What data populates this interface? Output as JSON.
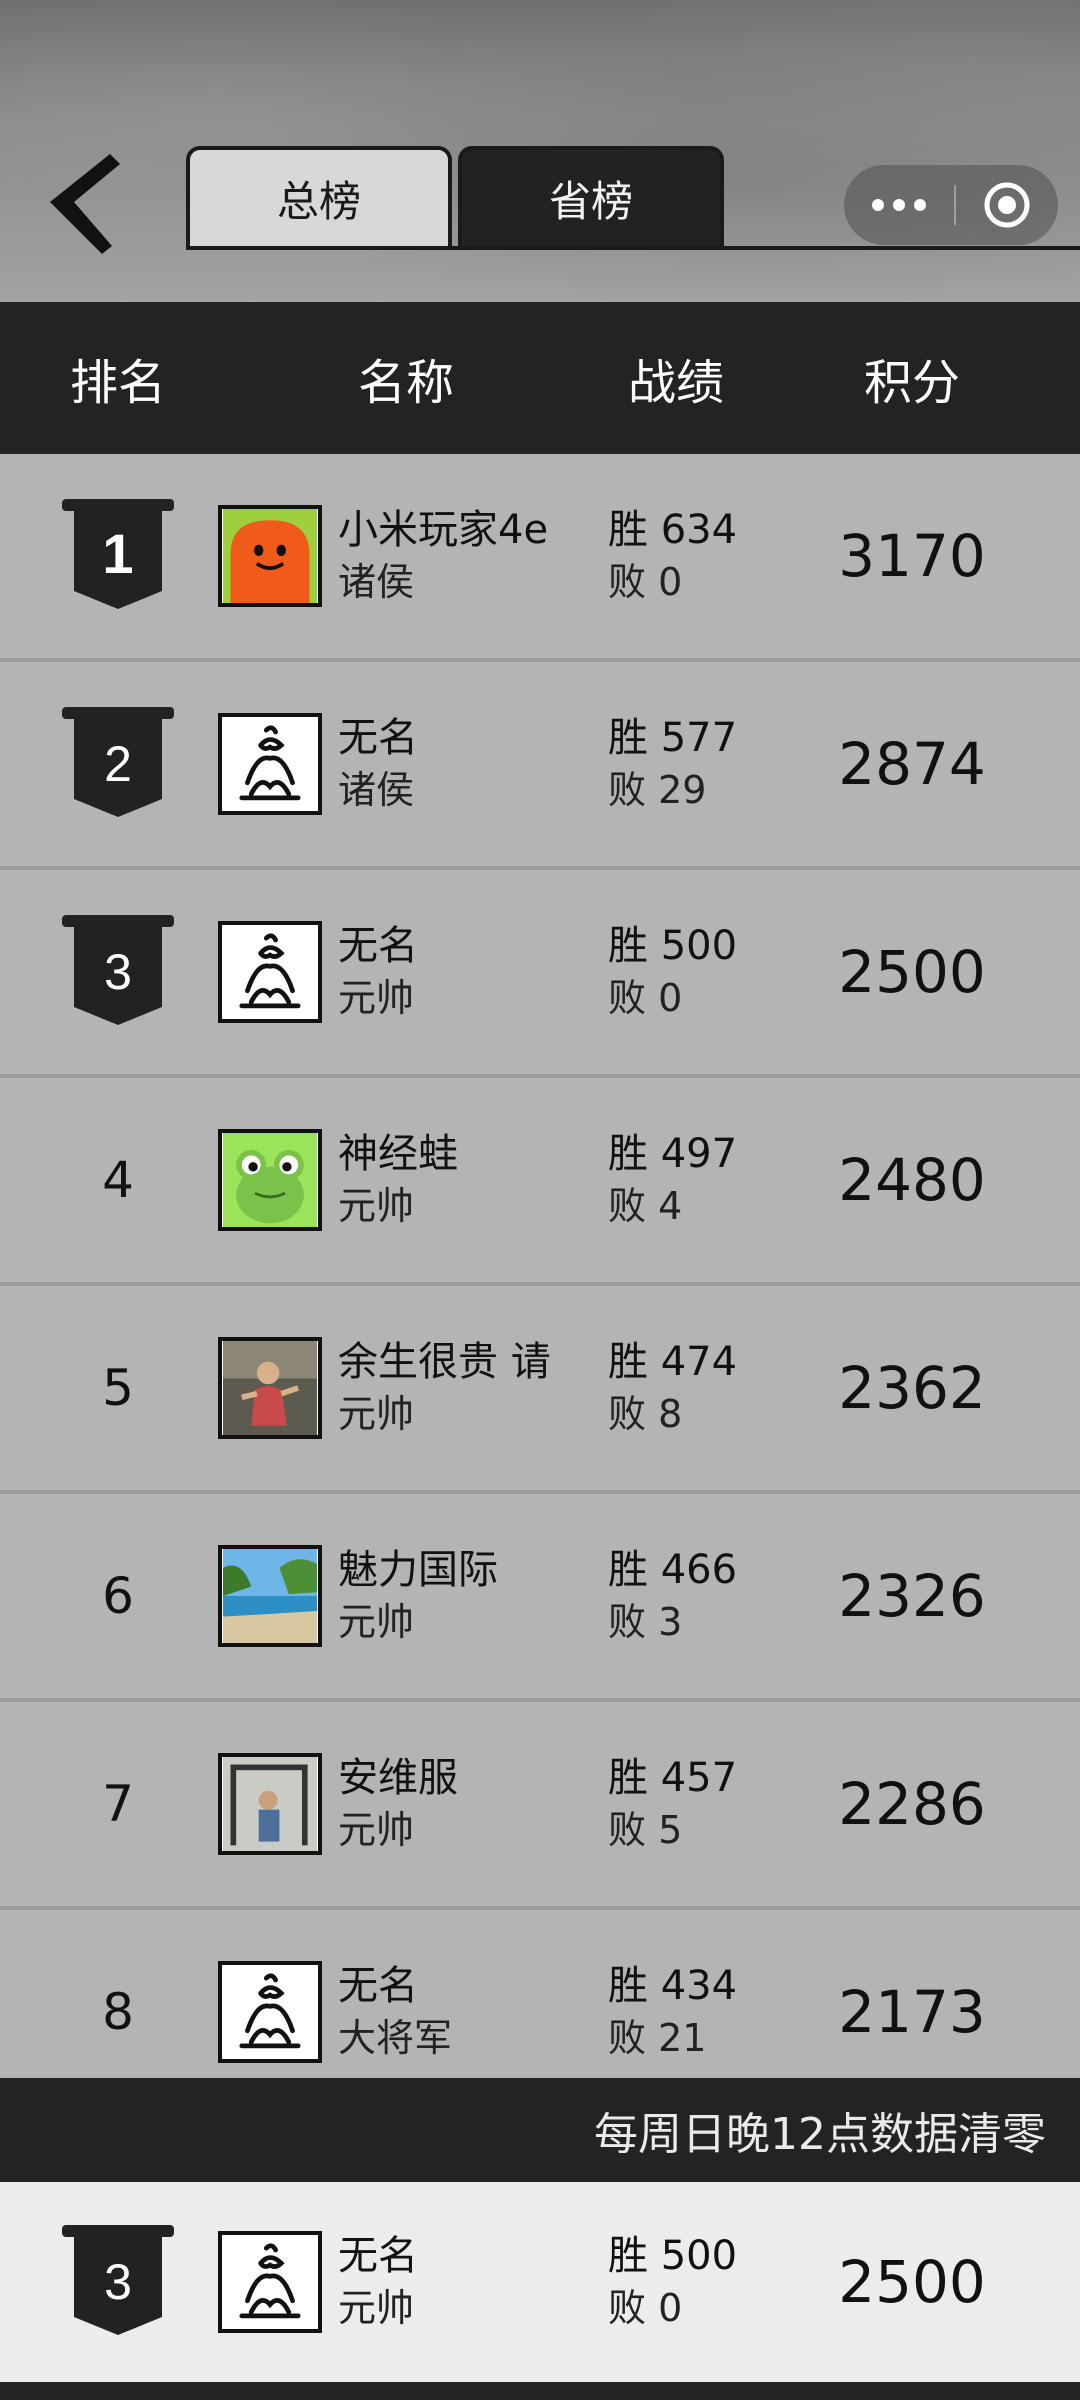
{
  "tabs": {
    "total": "总榜",
    "province": "省榜"
  },
  "header": {
    "rank": "排名",
    "name": "名称",
    "record": "战绩",
    "score": "积分"
  },
  "rows": [
    {
      "rank": "1",
      "name": "小米玩家4e",
      "title": "诸侯",
      "win": "胜 634",
      "lose": "败 0",
      "score": "3170",
      "avatar": "orange-smiley"
    },
    {
      "rank": "2",
      "name": "无名",
      "title": "诸侯",
      "win": "胜 577",
      "lose": "败 29",
      "score": "2874",
      "avatar": "ink-figure"
    },
    {
      "rank": "3",
      "name": "无名",
      "title": "元帅",
      "win": "胜 500",
      "lose": "败 0",
      "score": "2500",
      "avatar": "ink-figure"
    },
    {
      "rank": "4",
      "name": "神经蛙",
      "title": "元帅",
      "win": "胜 497",
      "lose": "败 4",
      "score": "2480",
      "avatar": "frog"
    },
    {
      "rank": "5",
      "name": "余生很贵 请",
      "title": "元帅",
      "win": "胜 474",
      "lose": "败 8",
      "score": "2362",
      "avatar": "photo-person"
    },
    {
      "rank": "6",
      "name": "魅力国际",
      "title": "元帅",
      "win": "胜 466",
      "lose": "败 3",
      "score": "2326",
      "avatar": "photo-beach"
    },
    {
      "rank": "7",
      "name": "安维服",
      "title": "元帅",
      "win": "胜 457",
      "lose": "败 5",
      "score": "2286",
      "avatar": "photo-gym"
    },
    {
      "rank": "8",
      "name": "无名",
      "title": "大将军",
      "win": "胜 434",
      "lose": "败 21",
      "score": "2173",
      "avatar": "ink-figure"
    }
  ],
  "notice": "每周日晚12点数据清零",
  "me": {
    "rank": "3",
    "name": "无名",
    "title": "元帅",
    "win": "胜 500",
    "lose": "败 0",
    "score": "2500",
    "avatar": "ink-figure"
  },
  "colors": {
    "dark": "#232323",
    "row_bg": "#b4b4b4",
    "my_row_bg": "#ececec",
    "tab_active_bg": "#d8d8d8"
  }
}
